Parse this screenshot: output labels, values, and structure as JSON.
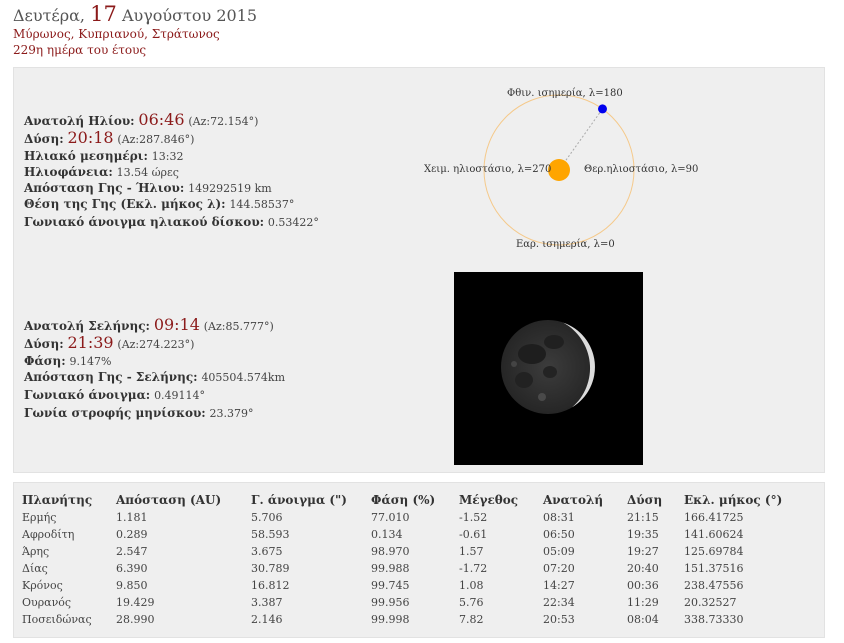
{
  "header": {
    "weekday": "Δευτέρα,",
    "day": "17",
    "month_year": "Αυγούστου 2015",
    "namedays": "Μύρωνος, Κυπριανού, Στράτωνος",
    "day_of_year": "229η ημέρα του έτους"
  },
  "sun": {
    "rise_label": "Ανατολή Ηλίου:",
    "rise_time": "06:46",
    "rise_az": "(Az:72.154°)",
    "set_label": "Δύση:",
    "set_time": "20:18",
    "set_az": "(Az:287.846°)",
    "noon_label": "Ηλιακό μεσημέρι:",
    "noon_value": "13:32",
    "daylight_label": "Ηλιοφάνεια:",
    "daylight_value": "13.54 ώρες",
    "distance_label": "Απόσταση Γης - Ήλιου:",
    "distance_value": "149292519 km",
    "longitude_label": "Θέση της Γης (Εκλ. μήκος λ):",
    "longitude_value": "144.58537°",
    "diameter_label": "Γωνιακό άνοιγμα ηλιακού δίσκου:",
    "diameter_value": "0.53422°"
  },
  "orbit": {
    "autumn_equinox": "Φθιν. ισημερία, λ=180",
    "winter_solstice": "Χειμ. ηλιοστάσιο, λ=270",
    "summer_solstice": "Θερ.ηλιοστάσιο, λ=90",
    "spring_equinox": "Εαρ. ισημερία, λ=0",
    "earth_longitude_deg": 144.58537,
    "colors": {
      "orbit": "#f5c98a",
      "sun": "#ffa500",
      "earth": "#0000ee",
      "line": "#aaaaaa"
    }
  },
  "moon": {
    "rise_label": "Ανατολή Σελήνης:",
    "rise_time": "09:14",
    "rise_az": "(Az:85.777°)",
    "set_label": "Δύση:",
    "set_time": "21:39",
    "set_az": "(Az:274.223°)",
    "phase_label": "Φάση:",
    "phase_value": "9.147%",
    "distance_label": "Απόσταση Γης - Σελήνης:",
    "distance_value": "405504.574km",
    "diameter_label": "Γωνιακό άνοιγμα:",
    "diameter_value": "0.49114°",
    "rotation_label": "Γωνία στροφής μηνίσκου:",
    "rotation_value": "23.379°"
  },
  "planets": {
    "headers": [
      "Πλανήτης",
      "Απόσταση (AU)",
      "Γ. άνοιγμα (\")",
      "Φάση (%)",
      "Μέγεθος",
      "Ανατολή",
      "Δύση",
      "Εκλ. μήκος (°)"
    ],
    "rows": [
      [
        "Ερμής",
        "1.181",
        "5.706",
        "77.010",
        "-1.52",
        "08:31",
        "21:15",
        "166.41725"
      ],
      [
        "Αφροδίτη",
        "0.289",
        "58.593",
        "0.134",
        "-0.61",
        "06:50",
        "19:35",
        "141.60624"
      ],
      [
        "Άρης",
        "2.547",
        "3.675",
        "98.970",
        "1.57",
        "05:09",
        "19:27",
        "125.69784"
      ],
      [
        "Δίας",
        "6.390",
        "30.789",
        "99.988",
        "-1.72",
        "07:20",
        "20:40",
        "151.37516"
      ],
      [
        "Κρόνος",
        "9.850",
        "16.812",
        "99.745",
        "1.08",
        "14:27",
        "00:36",
        "238.47556"
      ],
      [
        "Ουρανός",
        "19.429",
        "3.387",
        "99.956",
        "5.76",
        "22:34",
        "11:29",
        "20.32527"
      ],
      [
        "Ποσειδώνας",
        "28.990",
        "2.146",
        "99.998",
        "7.82",
        "20:53",
        "08:04",
        "338.73330"
      ]
    ]
  }
}
